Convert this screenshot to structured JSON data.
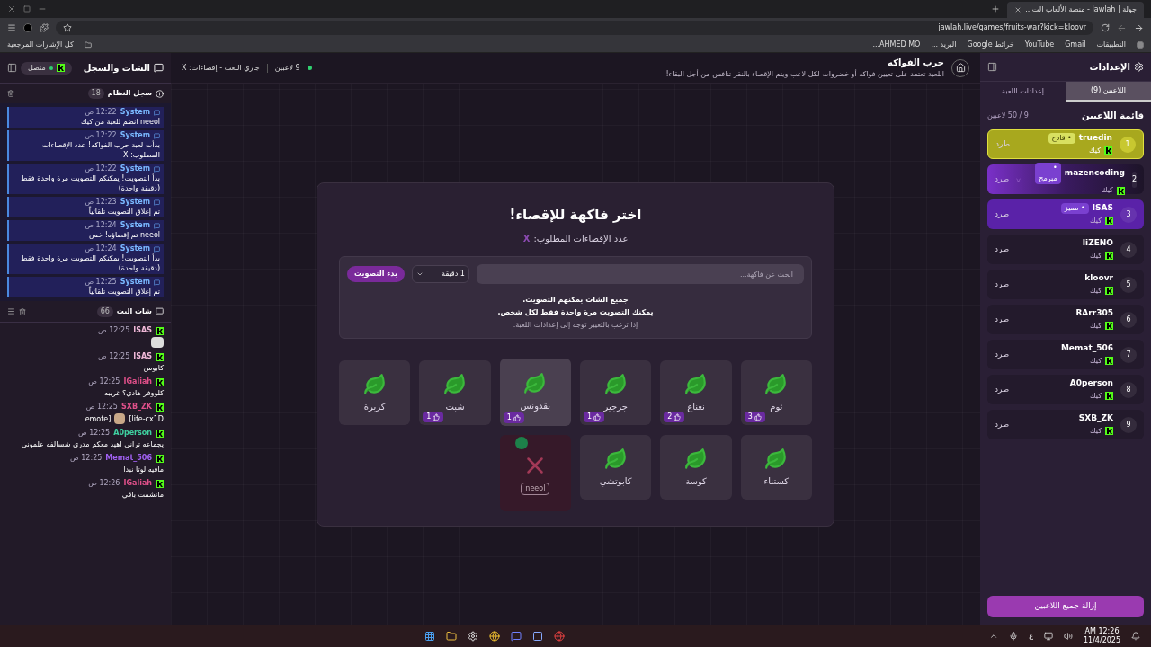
{
  "browser": {
    "tab_title": "جولة | Jawlah - منصة الألعاب الت...",
    "url": "jawlah.live/games/fruits-war?kick=kloovr",
    "bookmarks": [
      "التطبيقات",
      "Gmail",
      "YouTube",
      "خرائط Google",
      "البريد ...",
      "AHMED MO..."
    ],
    "all_bookmarks": "كل الإشارات المرجعية"
  },
  "settings_panel": {
    "title": "الإعدادات",
    "tabs": [
      {
        "label": "اللاعبين (9)",
        "selected": true
      },
      {
        "label": "إعدادات اللعبة",
        "selected": false
      }
    ],
    "list_title": "قائمة اللاعبين",
    "count": "9 / 50 لاعبين",
    "players": [
      {
        "rank": "1",
        "name": "truedin",
        "platform": "كيك",
        "badge": "• قادح",
        "kind": "gold",
        "kick": "طرد"
      },
      {
        "rank": "2",
        "name": "mazencoding",
        "platform": "كيك",
        "badge": "• مبرمج",
        "kind": "glow",
        "kick": "طرد"
      },
      {
        "rank": "3",
        "name": "ISAS",
        "platform": "كيك",
        "badge": "• مميز",
        "kind": "purple",
        "kick": "طرد"
      },
      {
        "rank": "4",
        "name": "IiZENO",
        "platform": "كيك",
        "kind": "plain",
        "kick": "طرد"
      },
      {
        "rank": "5",
        "name": "kloovr",
        "platform": "كيك",
        "kind": "plain",
        "kick": "طرد"
      },
      {
        "rank": "6",
        "name": "RArr305",
        "platform": "كيك",
        "kind": "plain",
        "kick": "طرد"
      },
      {
        "rank": "7",
        "name": "Memat_506",
        "platform": "كيك",
        "kind": "plain",
        "kick": "طرد"
      },
      {
        "rank": "8",
        "name": "A0person",
        "platform": "كيك",
        "kind": "plain",
        "kick": "طرد"
      },
      {
        "rank": "9",
        "name": "SXB_ZK",
        "platform": "كيك",
        "kind": "plain",
        "kick": "طرد"
      }
    ],
    "remove_all": "إزالة جميع اللاعبين"
  },
  "header": {
    "title": "حرب الفواكه",
    "subtitle": "اللعبة تعتمد على تعيين فواكه أو خضروات لكل لاعب ويتم الإقصاء بالنقر تنافس من أجل البقاء!",
    "players": "9 لاعبين",
    "status": "جاري اللعب - إقصاءات: X"
  },
  "modal": {
    "title": "اختر فاكهة للإقصاء!",
    "required_label": "عدد الإقصاءات المطلوب:",
    "required_value": "X",
    "search_placeholder": "ابحث عن فاكهة...",
    "duration": "1 دقيقة",
    "start": "بدء التصويت",
    "info": [
      "جميع الشات يمكنهم التصويت.",
      "يمكنك التصويت مرة واحدة فقط لكل شخص."
    ],
    "hint": "إذا ترغب بالتغيير توجه إلى إعدادات اللعبة.",
    "items": [
      {
        "label": "ثوم",
        "votes": "3",
        "hovered": false,
        "eliminated": false
      },
      {
        "label": "نعناع",
        "votes": "2",
        "hovered": false,
        "eliminated": false
      },
      {
        "label": "جرجير",
        "votes": "1",
        "hovered": false,
        "eliminated": false
      },
      {
        "label": "بقدونس",
        "votes": "1",
        "hovered": true,
        "eliminated": false
      },
      {
        "label": "شبت",
        "votes": "1",
        "hovered": false,
        "eliminated": false
      },
      {
        "label": "كزبرة",
        "hovered": false,
        "eliminated": false
      },
      {
        "label": "كستناء",
        "hovered": false,
        "eliminated": false
      },
      {
        "label": "كوسة",
        "hovered": false,
        "eliminated": false
      },
      {
        "label": "كابوتشي",
        "hovered": false,
        "eliminated": false
      },
      {
        "owner": "neeol",
        "eliminated": true
      }
    ]
  },
  "chat_panel": {
    "title": "الشات والسجل",
    "connection": "متصل",
    "log_title": "سجل النظام",
    "log_count": "18",
    "log": [
      {
        "sender": "System",
        "time": "12:22 ص",
        "text": "neeol انضم للعبة من كيك"
      },
      {
        "sender": "System",
        "time": "12:22 ص",
        "text": "بدأت لعبة حرب الفواكه! عدد الإقصاءات المطلوب: X"
      },
      {
        "sender": "System",
        "time": "12:22 ص",
        "text": "بدأ التصويت! يمكنكم التصويت مرة واحدة فقط (دقيقة واحدة)"
      },
      {
        "sender": "System",
        "time": "12:23 ص",
        "text": "تم إغلاق التصويت تلقائياً"
      },
      {
        "sender": "System",
        "time": "12:24 ص",
        "text": "neeol تم إقصاؤه! خس"
      },
      {
        "sender": "System",
        "time": "12:24 ص",
        "text": "بدأ التصويت! يمكنكم التصويت مرة واحدة فقط (دقيقة واحدة)"
      },
      {
        "sender": "System",
        "time": "12:25 ص",
        "text": "تم إغلاق التصويت تلقائياً"
      }
    ],
    "chat_title": "شات البث",
    "chat_count": "66",
    "messages": [
      {
        "user": "ISAS",
        "color": "#f0b8d8",
        "time": "12:25 ص",
        "kind": "emote"
      },
      {
        "user": "ISAS",
        "color": "#f0b8d8",
        "time": "12:25 ص",
        "kind": "text",
        "text": "كابوس"
      },
      {
        "user": "IGaliah",
        "color": "#e0508a",
        "time": "12:25 ص",
        "kind": "text",
        "text": "كلووفر هادي؟ غريبه"
      },
      {
        "user": "SXB_ZK",
        "color": "#e0508a",
        "time": "12:25 ص",
        "kind": "mixed",
        "before": "[emote",
        "after": "life-cx1D]"
      },
      {
        "user": "A0person",
        "color": "#3fd0a0",
        "time": "12:25 ص",
        "kind": "text",
        "text": "يجماعه تراني اهيد معكم مدري شسالفه علموني"
      },
      {
        "user": "Memat_506",
        "color": "#a060f0",
        "time": "12:25 ص",
        "kind": "text",
        "text": "مافيه لوتا نبدا"
      },
      {
        "user": "IGaliah",
        "color": "#e0508a",
        "time": "12:26 ص",
        "kind": "text",
        "text": "مانشمت باقي"
      }
    ]
  },
  "taskbar": {
    "lang": "ع",
    "time": "12:26 AM",
    "date": "11/4/2025"
  }
}
